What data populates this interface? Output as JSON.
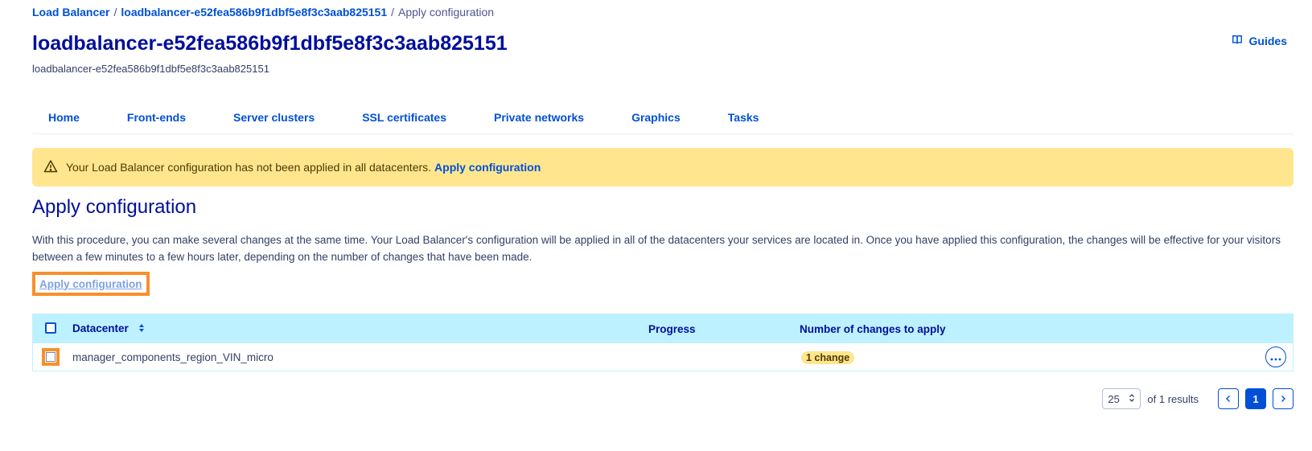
{
  "breadcrumb": {
    "items": [
      {
        "label": "Load Balancer"
      },
      {
        "label": "loadbalancer-e52fea586b9f1dbf5e8f3c3aab825151"
      }
    ],
    "current": "Apply configuration",
    "separator": "/"
  },
  "header": {
    "title": "loadbalancer-e52fea586b9f1dbf5e8f3c3aab825151",
    "subtitle": "loadbalancer-e52fea586b9f1dbf5e8f3c3aab825151",
    "guides_label": "Guides"
  },
  "tabs": [
    {
      "label": "Home"
    },
    {
      "label": "Front-ends"
    },
    {
      "label": "Server clusters"
    },
    {
      "label": "SSL certificates"
    },
    {
      "label": "Private networks"
    },
    {
      "label": "Graphics"
    },
    {
      "label": "Tasks"
    }
  ],
  "alert": {
    "message": "Your Load Balancer configuration has not been applied in all datacenters.",
    "link_label": "Apply configuration"
  },
  "main": {
    "title": "Apply configuration",
    "description": "With this procedure, you can make several changes at the same time. Your Load Balancer's configuration will be applied in all of the datacenters your services are located in. Once you have applied this configuration, the changes will be effective for your visitors between a few minutes to a few hours later, depending on the number of changes that have been made.",
    "apply_button": "Apply configuration"
  },
  "table": {
    "columns": {
      "datacenter": "Datacenter",
      "progress": "Progress",
      "changes": "Number of changes to apply"
    },
    "rows": [
      {
        "datacenter": "manager_components_region_VIN_micro",
        "progress": "",
        "changes": "1 change"
      }
    ]
  },
  "pagination": {
    "page_size": "25",
    "results_text": "of 1 results",
    "current_page": "1"
  },
  "colors": {
    "accent": "#0050d7",
    "title": "#000e9c",
    "warning_bg": "#ffe68e",
    "table_header_bg": "#bef1ff",
    "highlight": "#f7902b"
  },
  "icons": {
    "guides": "book-icon",
    "alert": "warning-triangle-icon",
    "sort": "sort-icon",
    "more": "ellipsis-icon",
    "prev": "chevron-left-icon",
    "next": "chevron-right-icon"
  }
}
